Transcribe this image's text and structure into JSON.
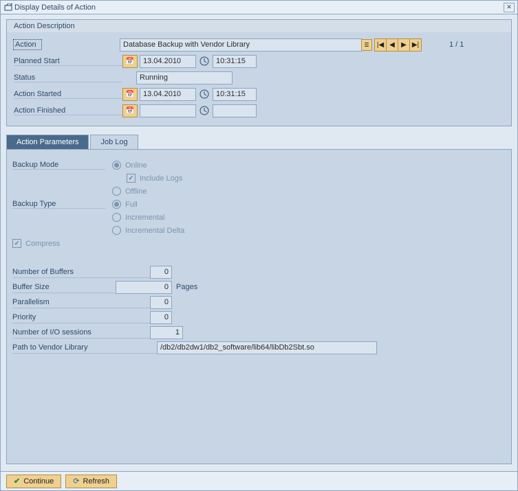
{
  "window": {
    "title": "Display Details of Action"
  },
  "section": {
    "title": "Action Description"
  },
  "action": {
    "label": "Action",
    "value": "Database Backup with Vendor Library",
    "pager": "1  /  1"
  },
  "plannedStart": {
    "label": "Planned Start",
    "date": "13.04.2010",
    "time": "10:31:15"
  },
  "status": {
    "label": "Status",
    "value": "Running"
  },
  "actionStarted": {
    "label": "Action Started",
    "date": "13.04.2010",
    "time": "10:31:15"
  },
  "actionFinished": {
    "label": "Action Finished",
    "date": "",
    "time": ""
  },
  "tabs": {
    "parameters": "Action Parameters",
    "jobLog": "Job Log"
  },
  "backupMode": {
    "label": "Backup Mode",
    "online": "Online",
    "includeLogs": "Include Logs",
    "offline": "Offline"
  },
  "backupType": {
    "label": "Backup Type",
    "full": "Full",
    "incremental": "Incremental",
    "incrementalDelta": "Incremental Delta"
  },
  "compress": "Compress",
  "fields": {
    "numBuffers": {
      "label": "Number of Buffers",
      "value": "0"
    },
    "bufferSize": {
      "label": "Buffer Size",
      "value": "0",
      "unit": "Pages"
    },
    "parallelism": {
      "label": "Parallelism",
      "value": "0"
    },
    "priority": {
      "label": "Priority",
      "value": "0"
    },
    "ioSessions": {
      "label": "Number of I/O sessions",
      "value": "1"
    },
    "vendorLib": {
      "label": "Path to Vendor Library",
      "value": "/db2/db2dw1/db2_software/lib64/libDb2Sbt.so"
    }
  },
  "buttons": {
    "continue": "Continue",
    "refresh": "Refresh"
  }
}
